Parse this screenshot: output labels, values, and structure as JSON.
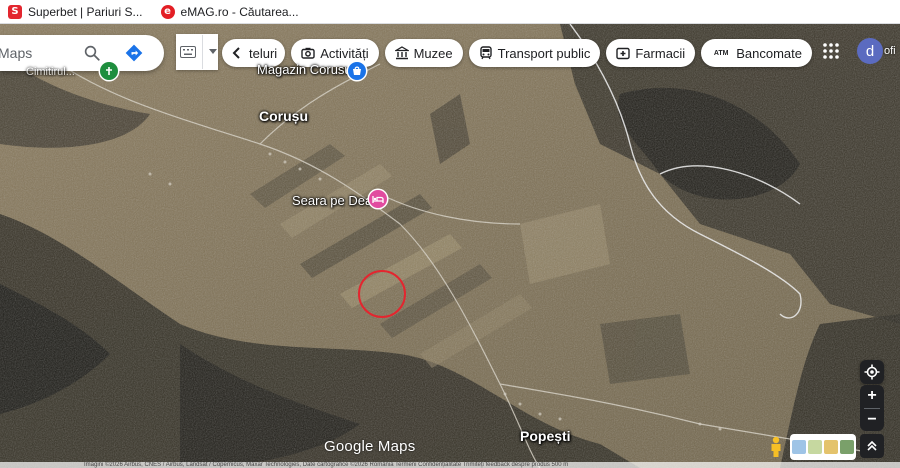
{
  "browser": {
    "bookmarks": [
      {
        "label": "Superbet | Pariuri S...",
        "icon": "superbet-icon",
        "icon_char": "S",
        "color": "#e3262f"
      },
      {
        "label": "eMAG.ro - Căutarea...",
        "icon": "emag-icon",
        "icon_char": "e",
        "color": "#e31e24"
      }
    ]
  },
  "search": {
    "placeholder": "Maps",
    "search_icon": "search-icon",
    "directions_icon": "directions-icon"
  },
  "chips": [
    {
      "label": "teluri",
      "icon": "back-chevron-icon"
    },
    {
      "label": "Activități",
      "icon": "camera-icon"
    },
    {
      "label": "Muzee",
      "icon": "museum-icon"
    },
    {
      "label": "Transport public",
      "icon": "transit-icon"
    },
    {
      "label": "Farmacii",
      "icon": "pharmacy-icon"
    },
    {
      "label": "Bancomate",
      "icon": "atm-icon"
    }
  ],
  "account": {
    "avatar_letter": "d",
    "tail_text": "ofi"
  },
  "map": {
    "places": [
      {
        "name": "Magazin Corusu",
        "pin": "store-pin-icon",
        "pin_color": "#1a73e8"
      },
      {
        "name": "Corușu",
        "kind": "locality"
      },
      {
        "name": "Seara pe Deal",
        "pin": "hotel-pin-icon",
        "pin_color": "#e14c9f"
      },
      {
        "name": "Popești",
        "kind": "locality"
      },
      {
        "name": "Cimitirul...",
        "pin": "green-pin-icon",
        "pin_color": "#1e8e3e"
      }
    ],
    "highlight_color": "#e3262f",
    "logo": "Google Maps",
    "attribution": "Imagini ©2026 Airbus, CNES / Airbus, Landsat / Copernicus, Maxar Technologies, Date cartografice ©2026   România   Termeni   Confidențialitate   Trimiteți feedback despre produs   500 m"
  },
  "controls": {
    "locate_icon": "my-location-icon",
    "zoom_in": "+",
    "zoom_out": "−",
    "pegman_icon": "pegman-icon",
    "layers_icon": "layers-icon",
    "expand_icon": "expand-icon"
  }
}
